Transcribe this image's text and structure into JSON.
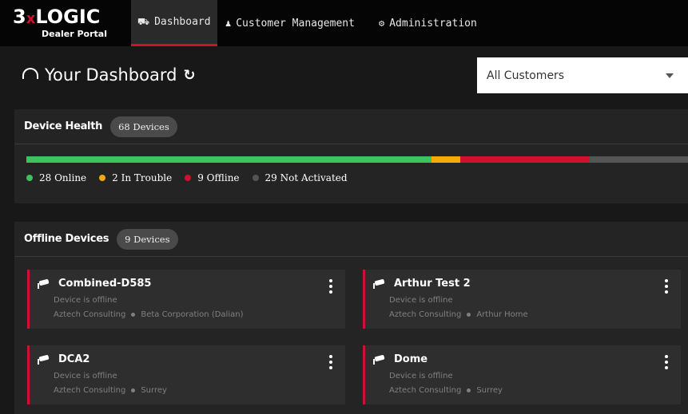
{
  "brand": {
    "name_prefix": "3",
    "name_x": "x",
    "name_suffix": "LOGIC",
    "subtitle": "Dealer Portal",
    "accent": "#d0102f"
  },
  "nav": {
    "tabs": [
      {
        "label": "Dashboard",
        "icon": "dashboard-gauge-icon",
        "active": true
      },
      {
        "label": "Customer Management",
        "icon": "users-icon",
        "active": false
      },
      {
        "label": "Administration",
        "icon": "gear-icon",
        "active": false
      }
    ]
  },
  "dashboard": {
    "title": "Your Dashboard",
    "customer_filter": {
      "selected": "All Customers"
    }
  },
  "device_health": {
    "title": "Device Health",
    "badge": "68 Devices",
    "segments": [
      {
        "key": "online",
        "label": "28 Online",
        "count": 28,
        "color": "#3cc35d"
      },
      {
        "key": "trouble",
        "label": "2 In Trouble",
        "count": 2,
        "color": "#f5a90a"
      },
      {
        "key": "offline",
        "label": "9 Offline",
        "count": 9,
        "color": "#d0102f"
      },
      {
        "key": "not_activated",
        "label": "29 Not Activated",
        "count": 29,
        "color": "#555555"
      }
    ],
    "bar_fractions": {
      "online": 0.612,
      "trouble": 0.044,
      "offline": 0.196,
      "not_activated": 0.148
    }
  },
  "offline_devices": {
    "title": "Offline Devices",
    "badge": "9 Devices",
    "devices": [
      {
        "name": "Combined-D585",
        "status": "Device is offline",
        "dealer": "Aztech Consulting",
        "site": "Beta Corporation (Dalian)"
      },
      {
        "name": "Arthur Test 2",
        "status": "Device is offline",
        "dealer": "Aztech Consulting",
        "site": "Arthur Home"
      },
      {
        "name": "DCA2",
        "status": "Device is offline",
        "dealer": "Aztech Consulting",
        "site": "Surrey"
      },
      {
        "name": "Dome",
        "status": "Device is offline",
        "dealer": "Aztech Consulting",
        "site": "Surrey"
      }
    ]
  }
}
